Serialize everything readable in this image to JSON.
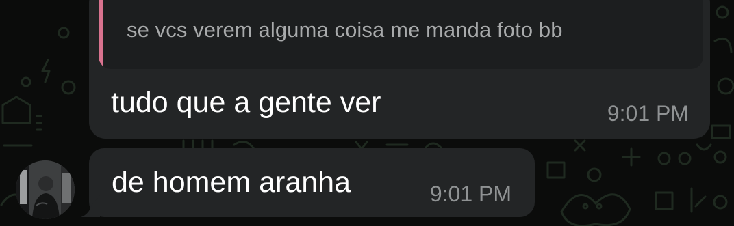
{
  "colors": {
    "background": "#0b0c0b",
    "bubble": "#232526",
    "quote_background": "#1c1e1f",
    "quote_accent": "#d9738f",
    "message_text": "#ffffff",
    "timestamp_text": "#8f9293"
  },
  "messages": [
    {
      "quoted_text": "se vcs verem alguma coisa me manda foto bb",
      "text": "tudo que a gente ver",
      "time": "9:01 PM"
    },
    {
      "text": "de homem aranha",
      "time": "9:01 PM"
    }
  ],
  "sender": {
    "avatar_icon": "user-photo-avatar"
  }
}
